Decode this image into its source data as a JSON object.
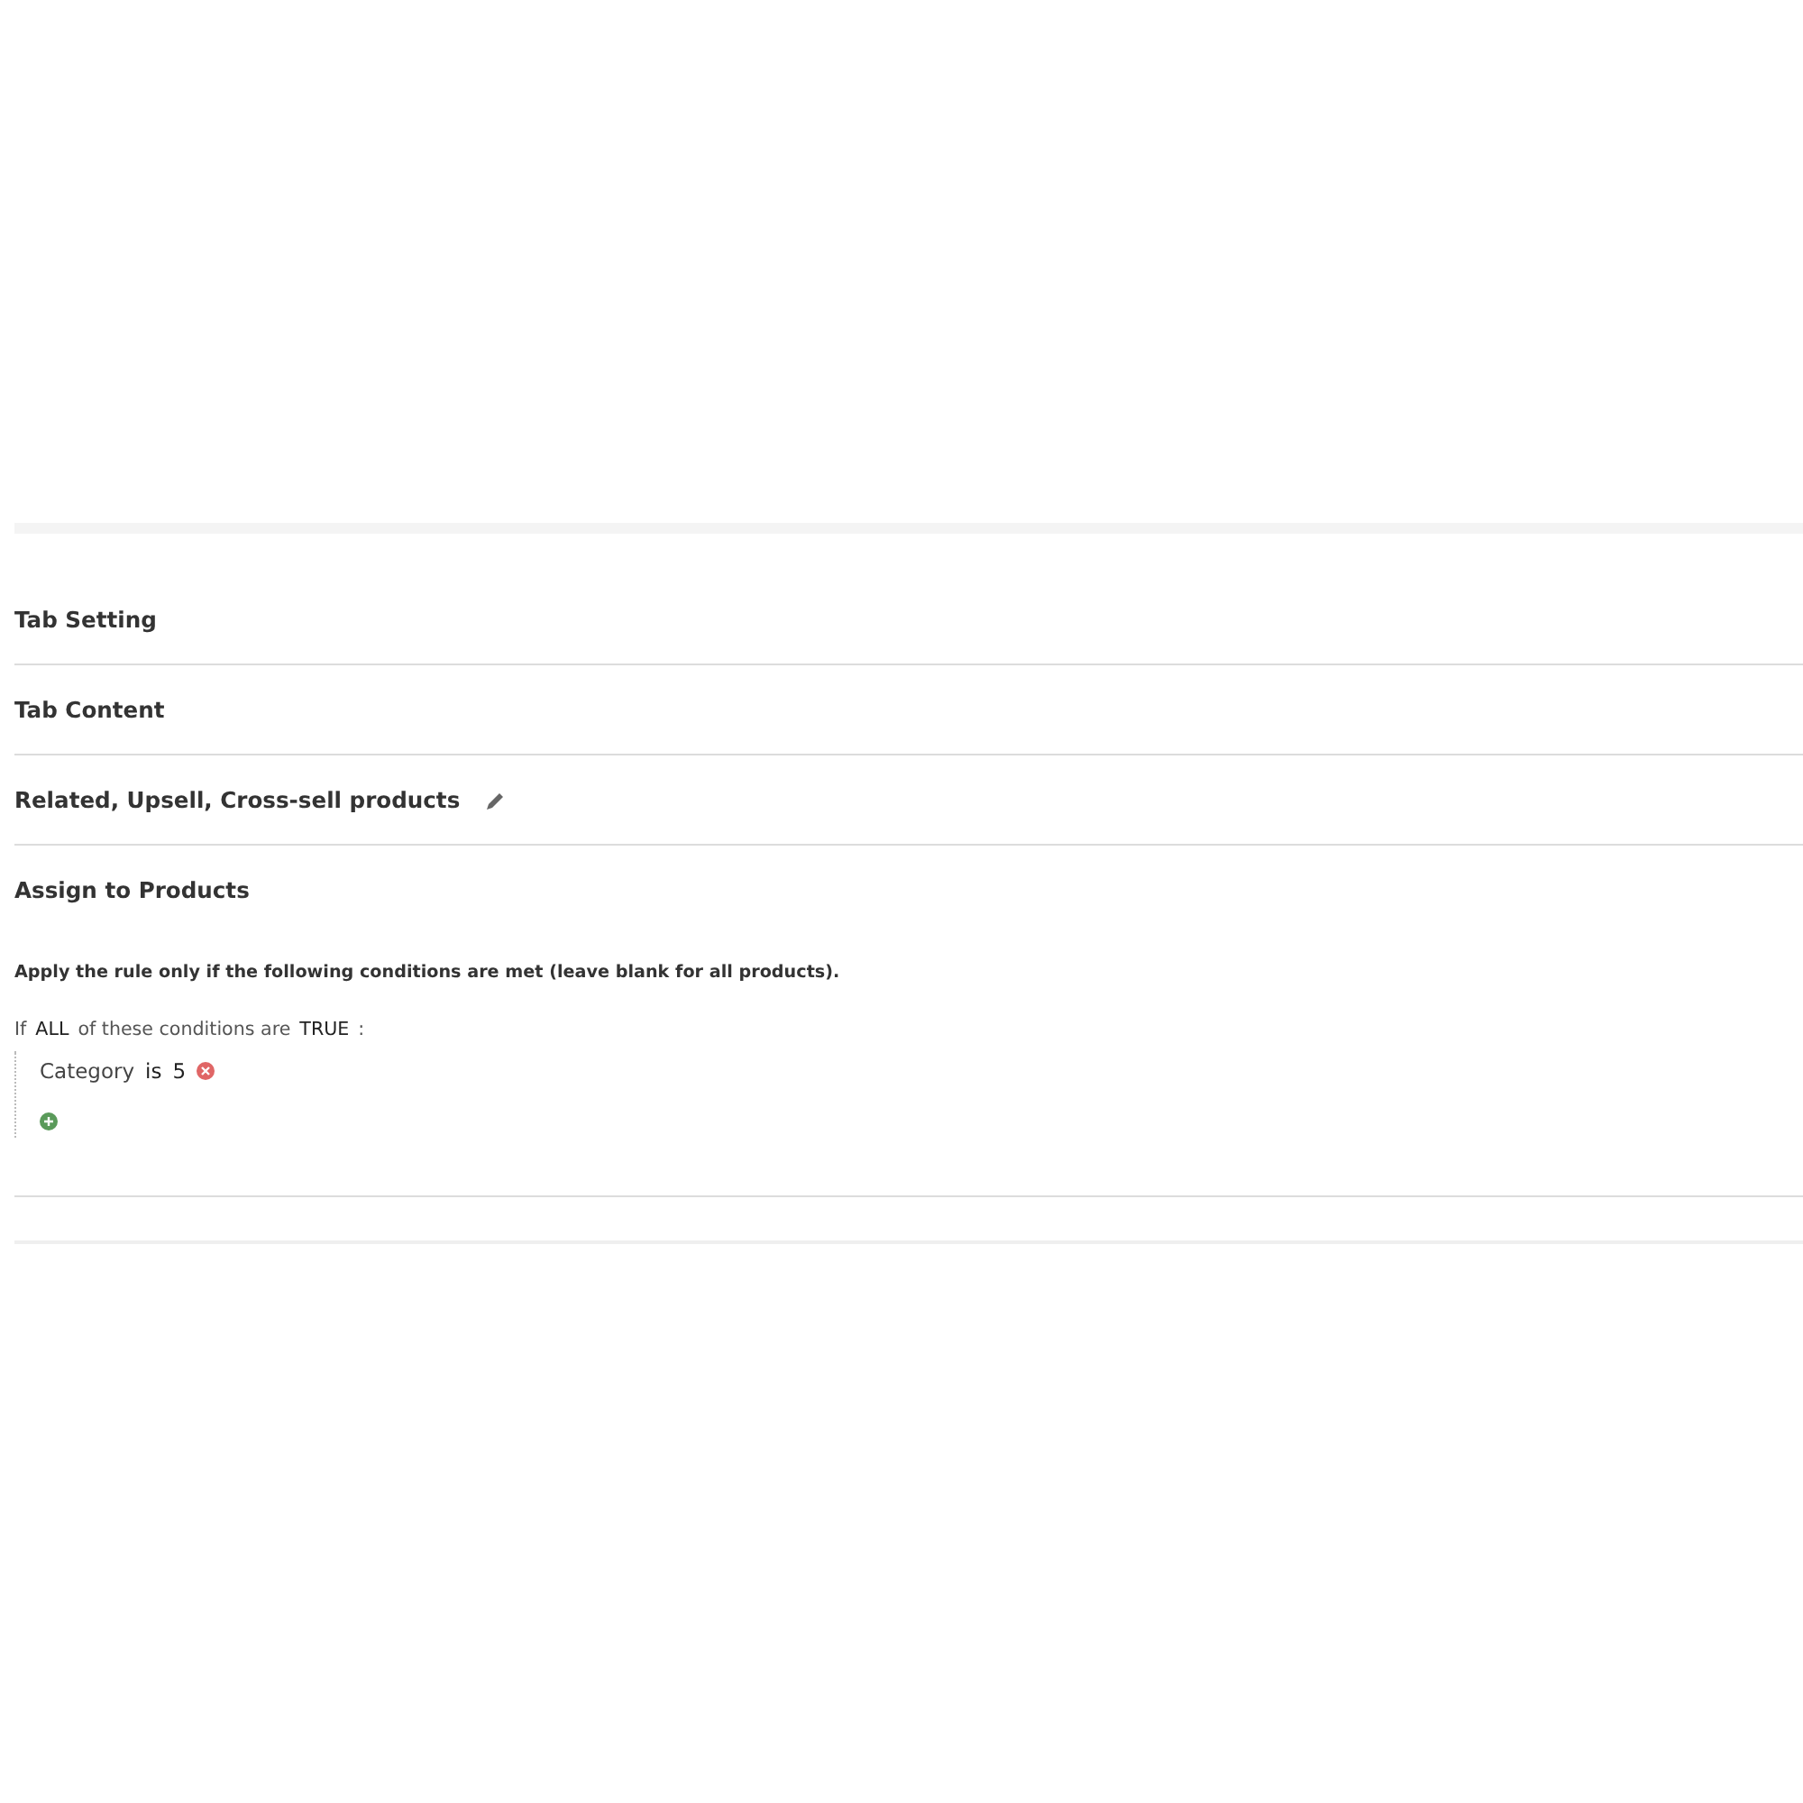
{
  "sections": [
    {
      "title": "Tab Setting",
      "editable": false
    },
    {
      "title": "Tab Content",
      "editable": false
    },
    {
      "title": "Related, Upsell, Cross-sell products",
      "editable": true
    },
    {
      "title": "Assign to Products",
      "editable": false
    }
  ],
  "conditions": {
    "intro": "Apply the rule only if the following conditions are met (leave blank for all products).",
    "prefix": "If",
    "aggregator": "ALL",
    "middle": "of these conditions are",
    "value": "TRUE",
    "suffix": ":",
    "rules": [
      {
        "attribute": "Category",
        "operator": "is",
        "value": "5"
      }
    ]
  }
}
